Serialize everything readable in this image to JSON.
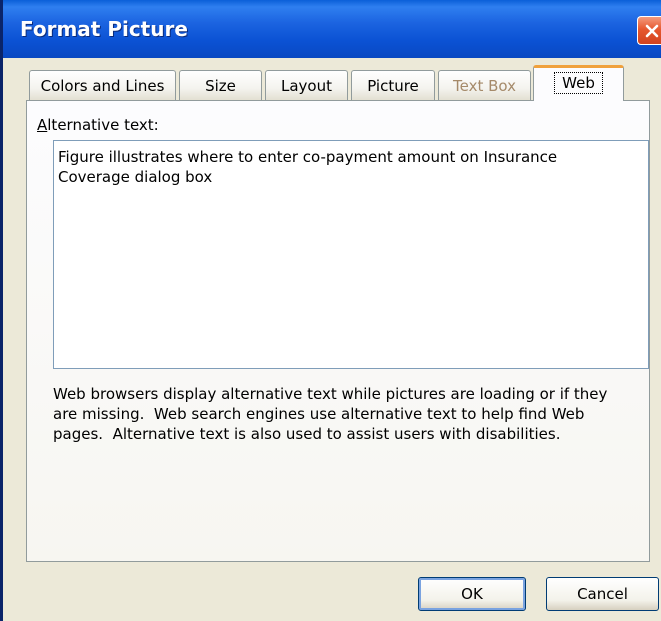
{
  "window": {
    "title": "Format Picture"
  },
  "tabs": [
    {
      "label": "Colors and Lines"
    },
    {
      "label": "Size"
    },
    {
      "label": "Layout"
    },
    {
      "label": "Picture"
    },
    {
      "label": "Text Box"
    },
    {
      "label": "Web"
    }
  ],
  "web_tab": {
    "alt_label_prefix": "A",
    "alt_label_rest": "lternative text:",
    "alt_text_value": "Figure illustrates where to enter co-payment amount on Insurance\nCoverage dialog box",
    "help_text": "Web browsers display alternative text while pictures are loading or if they\nare missing.  Web search engines use alternative text to help find Web\npages.  Alternative text is also used to assist users with disabilities."
  },
  "buttons": {
    "ok": "OK",
    "cancel": "Cancel"
  },
  "colors": {
    "title_bar": "#0b52d4",
    "dialog_bg": "#ece9d8",
    "active_tab_accent": "#f0a13c",
    "close_button": "#e6582f"
  },
  "icons": {
    "close": "close-icon"
  }
}
